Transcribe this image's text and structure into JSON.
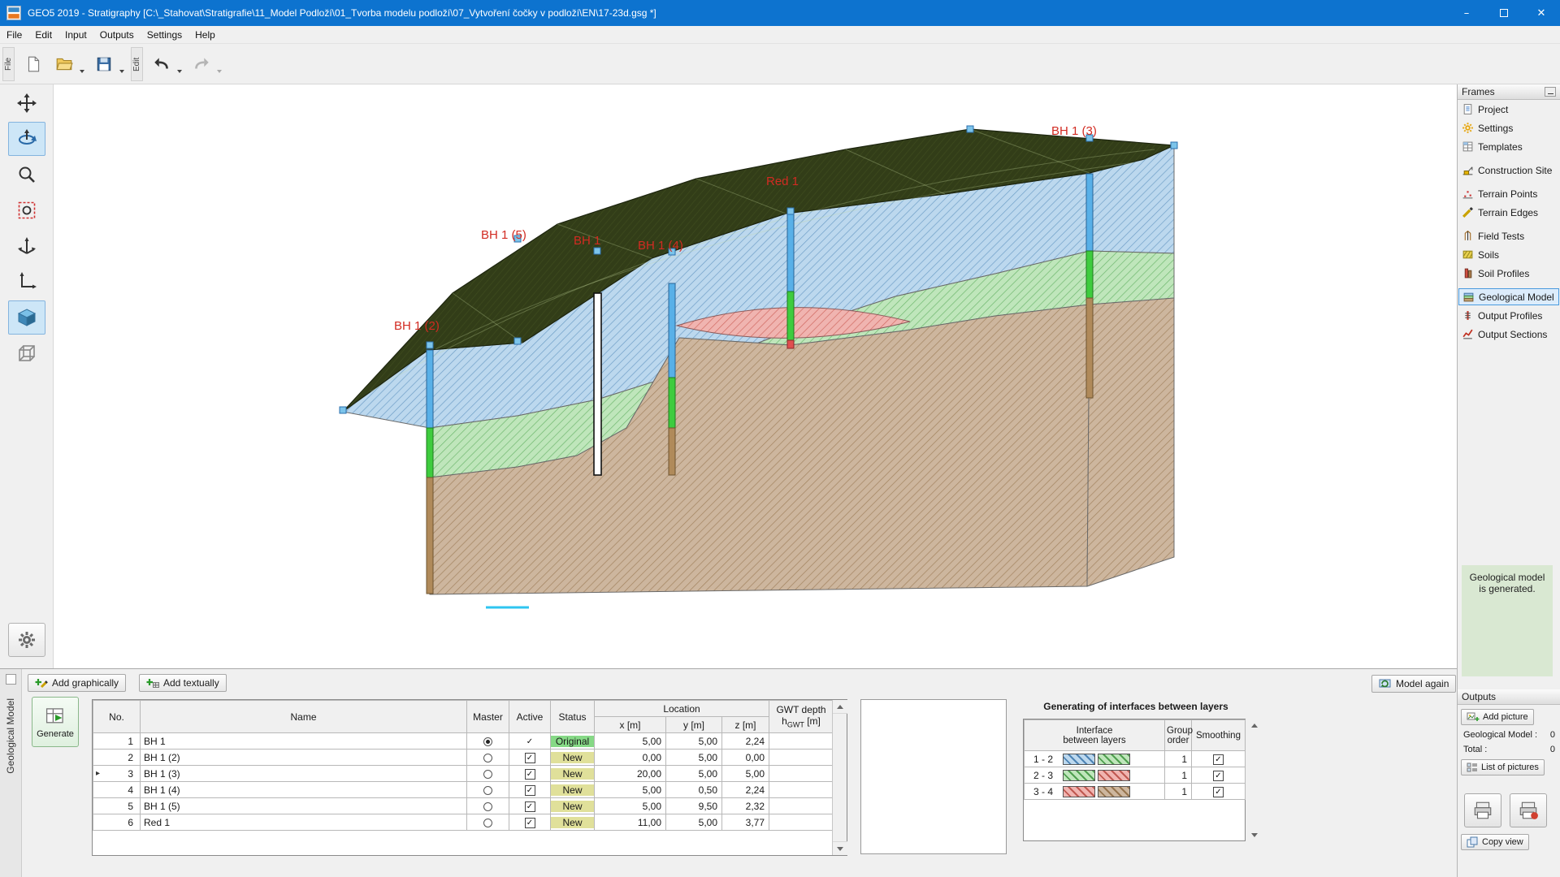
{
  "window": {
    "title": "GEO5 2019 - Stratigraphy [C:\\_Stahovat\\Stratigrafie\\11_Model Podloží\\01_Tvorba modelu podloží\\07_Vytvoření čočky v podloží\\EN\\17-23d.gsg *]",
    "controls": {
      "minimize": "–",
      "close": "✕"
    }
  },
  "menu": {
    "items": [
      "File",
      "Edit",
      "Input",
      "Outputs",
      "Settings",
      "Help"
    ]
  },
  "toolbar": {
    "file_tab": "File",
    "edit_tab": "Edit"
  },
  "frames": {
    "title": "Frames",
    "items": [
      "Project",
      "Settings",
      "Templates",
      "Construction Site",
      "Terrain Points",
      "Terrain Edges",
      "Field Tests",
      "Soils",
      "Soil Profiles",
      "Geological Model",
      "Output Profiles",
      "Output Sections"
    ],
    "selected": "Geological Model"
  },
  "status_box": {
    "text": "Geological model is generated."
  },
  "glyphs": {
    "check": "✓"
  },
  "scene": {
    "labels": {
      "bh1": "BH 1",
      "bh12": "BH 1 (2)",
      "bh13": "BH 1 (3)",
      "bh14": "BH 1 (4)",
      "bh15": "BH 1 (5)",
      "red1": "Red 1"
    }
  },
  "bottom": {
    "tab": "Geological Model",
    "add_graphically": "Add graphically",
    "add_textually": "Add textually",
    "model_again": "Model again",
    "generate": "Generate",
    "table": {
      "headers": {
        "no": "No.",
        "name": "Name",
        "master": "Master",
        "active": "Active",
        "status": "Status",
        "location": "Location",
        "x": "x [m]",
        "y": "y [m]",
        "z": "z [m]",
        "gwt_top": "GWT depth",
        "gwt_pre": "h",
        "gwt_sub": "GWT",
        "gwt_post": " [m]"
      },
      "rows": [
        {
          "no": "1",
          "marker": "",
          "name": "BH 1",
          "master_class": "sel",
          "active_class": "plain",
          "status": "Original",
          "status_class": "st-original",
          "x": "5,00",
          "y": "5,00",
          "z": "2,24",
          "gwt": ""
        },
        {
          "no": "2",
          "marker": "",
          "name": "BH 1 (2)",
          "master_class": "",
          "active_class": "boxed",
          "status": "New",
          "status_class": "st-new",
          "x": "0,00",
          "y": "5,00",
          "z": "0,00",
          "gwt": ""
        },
        {
          "no": "3",
          "marker": "▸",
          "name": "BH 1 (3)",
          "master_class": "",
          "active_class": "boxed",
          "status": "New",
          "status_class": "st-new",
          "x": "20,00",
          "y": "5,00",
          "z": "5,00",
          "gwt": ""
        },
        {
          "no": "4",
          "marker": "",
          "name": "BH 1 (4)",
          "master_class": "",
          "active_class": "boxed",
          "status": "New",
          "status_class": "st-new",
          "x": "5,00",
          "y": "0,50",
          "z": "2,24",
          "gwt": ""
        },
        {
          "no": "5",
          "marker": "",
          "name": "BH 1 (5)",
          "master_class": "",
          "active_class": "boxed",
          "status": "New",
          "status_class": "st-new",
          "x": "5,00",
          "y": "9,50",
          "z": "2,32",
          "gwt": ""
        },
        {
          "no": "6",
          "marker": "",
          "name": "Red 1",
          "master_class": "",
          "active_class": "boxed",
          "status": "New",
          "status_class": "st-new",
          "x": "11,00",
          "y": "5,00",
          "z": "3,77",
          "gwt": ""
        }
      ]
    },
    "interfaces": {
      "title": "Generating of interfaces between layers",
      "headers": {
        "interface_1": "Interface",
        "interface_2": "between layers",
        "group_1": "Group",
        "group_2": "order",
        "smoothing": "Smoothing"
      },
      "rows": [
        {
          "label": "1 - 2",
          "left": "sw-blue",
          "right": "sw-green",
          "order": "1"
        },
        {
          "label": "2 - 3",
          "left": "sw-green",
          "right": "sw-red",
          "order": "1"
        },
        {
          "label": "3 - 4",
          "left": "sw-red",
          "right": "sw-brown",
          "order": "1"
        }
      ]
    },
    "outputs": {
      "title": "Outputs",
      "add_picture": "Add picture",
      "geo_model_label": "Geological Model :",
      "geo_model_value": "0",
      "total_label": "Total :",
      "total_value": "0",
      "list_of_pictures": "List of pictures",
      "copy_view": "Copy view"
    }
  }
}
